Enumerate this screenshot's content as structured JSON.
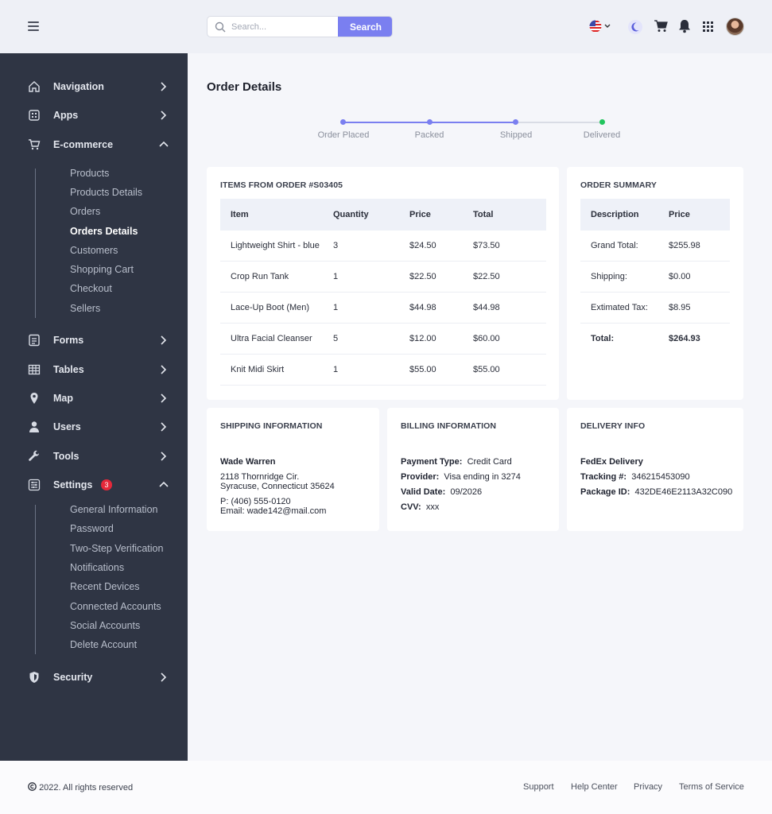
{
  "search": {
    "placeholder": "Search...",
    "button": "Search"
  },
  "sidebar": {
    "items": [
      {
        "label": "Navigation"
      },
      {
        "label": "Apps"
      },
      {
        "label": "E-commerce"
      },
      {
        "label": "Forms"
      },
      {
        "label": "Tables"
      },
      {
        "label": "Map"
      },
      {
        "label": "Users"
      },
      {
        "label": "Tools"
      },
      {
        "label": "Settings",
        "badge": "3"
      },
      {
        "label": "Security"
      }
    ],
    "ecommerce_sub": [
      "Products",
      "Products Details",
      "Orders",
      "Orders Details",
      "Customers",
      "Shopping Cart",
      "Checkout",
      "Sellers"
    ],
    "settings_sub": [
      "General Information",
      "Password",
      "Two-Step Verification",
      "Notifications",
      "Recent Devices",
      "Connected Accounts",
      "Social Accounts",
      "Delete Account"
    ]
  },
  "page": {
    "title": "Order Details"
  },
  "stepper": {
    "steps": [
      "Order Placed",
      "Packed",
      "Shipped",
      "Delivered"
    ],
    "active_color": "#7a7ff0",
    "done_color": "#22c55e"
  },
  "items": {
    "title": "ITEMS FROM ORDER #S03405",
    "headers": [
      "Item",
      "Quantity",
      "Price",
      "Total"
    ],
    "rows": [
      [
        "Lightweight Shirt - blue",
        "3",
        "$24.50",
        "$73.50"
      ],
      [
        "Crop Run Tank",
        "1",
        "$22.50",
        "$22.50"
      ],
      [
        "Lace-Up Boot (Men)",
        "1",
        "$44.98",
        "$44.98"
      ],
      [
        "Ultra Facial Cleanser",
        "5",
        "$12.00",
        "$60.00"
      ],
      [
        "Knit Midi Skirt",
        "1",
        "$55.00",
        "$55.00"
      ]
    ]
  },
  "summary": {
    "title": "ORDER SUMMARY",
    "headers": [
      "Description",
      "Price"
    ],
    "rows": [
      [
        "Grand Total:",
        "$255.98"
      ],
      [
        "Shipping:",
        "$0.00"
      ],
      [
        "Extimated Tax:",
        "$8.95"
      ],
      [
        "Total:",
        "$264.93"
      ]
    ]
  },
  "shipping": {
    "title": "SHIPPING INFORMATION",
    "name": "Wade Warren",
    "address1": "2118 Thornridge Cir.",
    "address2": "Syracuse, Connecticut 35624",
    "phone": "P: (406) 555-0120",
    "email": "Email: wade142@mail.com"
  },
  "billing": {
    "title": "BILLING INFORMATION",
    "payment_label": "Payment Type:",
    "payment_value": "Credit Card",
    "provider_label": "Provider:",
    "provider_value": "Visa ending in 3274",
    "valid_label": "Valid Date:",
    "valid_value": "09/2026",
    "cvv_label": "CVV:",
    "cvv_value": "xxx"
  },
  "delivery": {
    "title": "DELIVERY INFO",
    "carrier": "FedEx Delivery",
    "tracking_label": "Tracking #:",
    "tracking_value": "346215453090",
    "package_label": "Package ID:",
    "package_value": "432DE46E2113A32C090"
  },
  "footer": {
    "copyright": "2022. All rights reserved",
    "links": [
      "Support",
      "Help Center",
      "Privacy",
      "Terms of Service"
    ]
  },
  "icons": [
    "menu-icon",
    "search-icon",
    "us-flag-icon",
    "moon-icon",
    "cart-icon",
    "bell-icon",
    "apps-grid-icon",
    "avatar"
  ]
}
